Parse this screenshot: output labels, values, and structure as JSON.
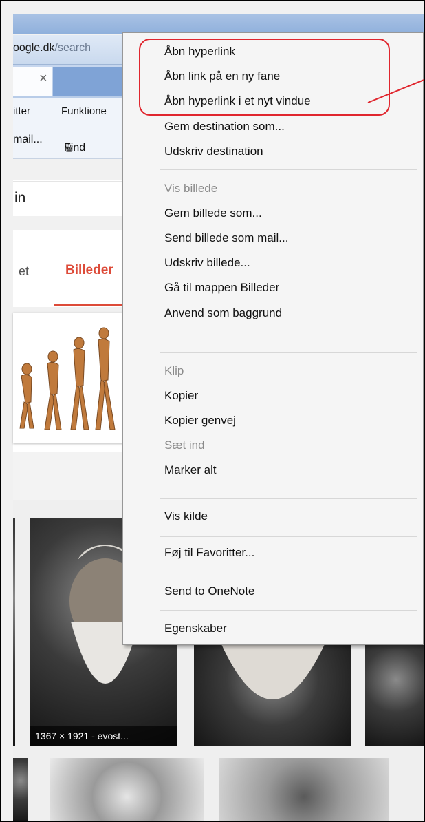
{
  "browser": {
    "url_host": "oogle.dk",
    "url_rest": "/search",
    "tab_close": "×",
    "menu": [
      "itter",
      "Funktione"
    ],
    "favorites": [
      "mail...",
      "Find"
    ]
  },
  "page": {
    "search_query": "in",
    "nav_tab_partial": "et",
    "nav_tab_active": "Billeder",
    "image_caption": "1367 × 1921 - evost..."
  },
  "context_menu": {
    "items": [
      {
        "label": "Åbn hyperlink",
        "enabled": true
      },
      {
        "label": "Åbn link på en ny fane",
        "enabled": true
      },
      {
        "label": "Åbn hyperlink i et nyt vindue",
        "enabled": true
      },
      {
        "label": "Gem destination som...",
        "enabled": true
      },
      {
        "label": "Udskriv destination",
        "enabled": true
      },
      {
        "label": "Vis billede",
        "enabled": false
      },
      {
        "label": "Gem billede som...",
        "enabled": true
      },
      {
        "label": "Send billede som mail...",
        "enabled": true
      },
      {
        "label": "Udskriv billede...",
        "enabled": true
      },
      {
        "label": "Gå til mappen Billeder",
        "enabled": true
      },
      {
        "label": "Anvend som baggrund",
        "enabled": true
      },
      {
        "label": "Klip",
        "enabled": false
      },
      {
        "label": "Kopier",
        "enabled": true
      },
      {
        "label": "Kopier genvej",
        "enabled": true
      },
      {
        "label": "Sæt ind",
        "enabled": false
      },
      {
        "label": "Marker alt",
        "enabled": true
      },
      {
        "label": "Vis kilde",
        "enabled": true
      },
      {
        "label": "Føj til Favoritter...",
        "enabled": true
      },
      {
        "label": "Send to OneNote",
        "enabled": true
      },
      {
        "label": "Egenskaber",
        "enabled": true
      }
    ]
  },
  "colors": {
    "annotation": "#e0262e",
    "google_red": "#dd4b39"
  }
}
